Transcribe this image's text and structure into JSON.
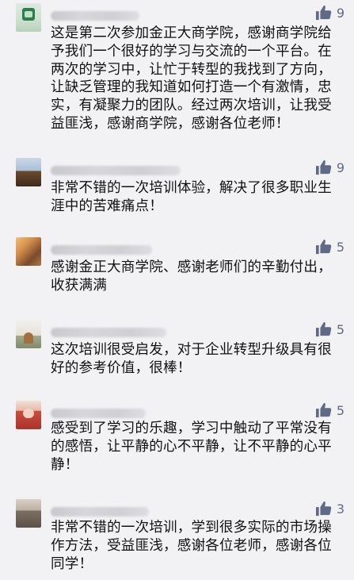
{
  "comments": [
    {
      "likes": "9",
      "text": "这是第二次参加金正大商学院，感谢商学院给予我们一个很好的学习与交流的一个平台。在两次的学习中，让忙于转型的我找到了方向，让缺乏管理的我知道如何打造一个有激情，忠实，有凝聚力的团队。经过两次培训，让我受益匪浅，感谢商学院，感谢各位老师！"
    },
    {
      "likes": "9",
      "text": "非常不错的一次培训体验，解决了很多职业生涯中的苦难痛点！"
    },
    {
      "likes": "5",
      "text": "感谢金正大商学院、感谢老师们的辛勤付出，收获满满"
    },
    {
      "likes": "5",
      "text": "这次培训很受启发，对于企业转型升级具有很好的参考价值，很棒！"
    },
    {
      "likes": "5",
      "text": "感受到了学习的乐趣，学习中触动了平常没有的感悟，让平静的心不平静，让不平静的心平静！"
    },
    {
      "likes": "3",
      "text": "非常不错的一次培训，学到很多实际的市场操作方法，受益匪浅，感谢各位老师，感谢各位同学！"
    }
  ],
  "icons": {
    "like": "thumbs-up-icon"
  },
  "colors": {
    "background": "#f2f2f5",
    "like_icon": "#5f6b86",
    "text": "#111111"
  }
}
